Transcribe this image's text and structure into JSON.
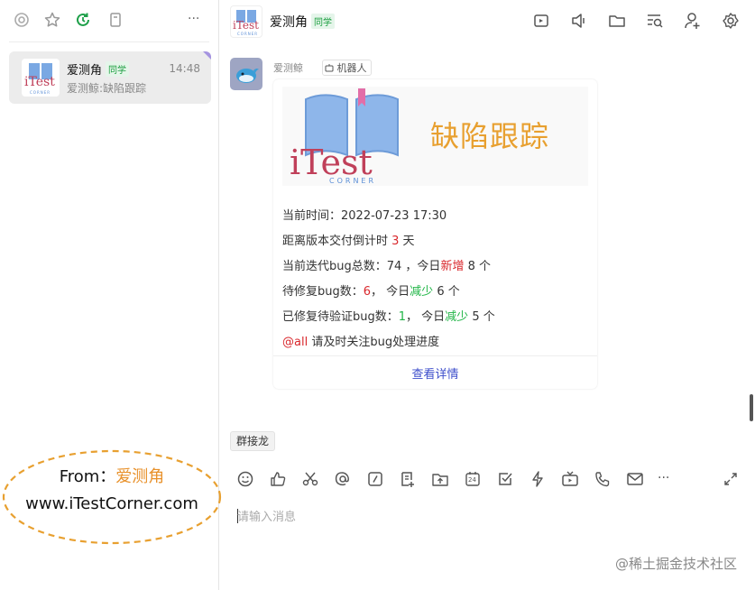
{
  "sidebar": {
    "icons": [
      "at-icon",
      "star-icon",
      "refresh-icon",
      "bookmark-icon",
      "more-icon"
    ],
    "more_label": "···",
    "conversation": {
      "name": "爱测角",
      "tag": "同学",
      "time": "14:48",
      "preview": "爱测鲸:缺陷跟踪",
      "logo_text": "iTest",
      "logo_sub": "CORNER"
    }
  },
  "stamp": {
    "prefix": "From：",
    "name": "爱测角",
    "url": "www.iTestCorner.com"
  },
  "header": {
    "title": "爱测角",
    "tag": "同学",
    "logo_text": "iTest",
    "logo_sub": "CORNER",
    "icons": [
      "screen-share-icon",
      "speaker-icon",
      "folder-icon",
      "search-list-icon",
      "add-user-icon",
      "settings-icon"
    ]
  },
  "message": {
    "sender": "爱测鲸",
    "robot_label": "机器人",
    "banner": {
      "title": "缺陷跟踪",
      "brand": "iTest",
      "brand_sub": "CORNER"
    },
    "lines": {
      "time_label": "当前时间：",
      "time_value": "2022-07-23 17:30",
      "countdown_prefix": "距离版本交付倒计时 ",
      "countdown_value": "3",
      "countdown_suffix": " 天",
      "total_prefix": "当前迭代bug总数：",
      "total_value": "74",
      "total_mid": " ，今日",
      "total_new_label": "新增",
      "total_new_value": " 8 个",
      "pending_prefix": "待修复bug数：",
      "pending_value": "6",
      "pending_mid": "， 今日",
      "pending_dec_label": "减少",
      "pending_dec_value": " 6 个",
      "verify_prefix": "已修复待验证bug数：",
      "verify_value": "1",
      "verify_mid": "， 今日",
      "verify_dec_label": "减少",
      "verify_dec_value": " 5 个",
      "at_label": "@all",
      "at_text": " 请及时关注bug处理进度"
    },
    "detail_link": "查看详情"
  },
  "chip": "群接龙",
  "toolbar": {
    "icons": [
      "emoji-icon",
      "thumb-up-icon",
      "scissors-icon",
      "at-icon",
      "slash-command-icon",
      "add-doc-icon",
      "upload-icon",
      "calendar-icon",
      "checkbox-icon",
      "lightning-icon",
      "live-tv-icon",
      "phone-icon",
      "mail-icon",
      "more-icon"
    ],
    "calendar_label": "24",
    "more_label": "···"
  },
  "input": {
    "placeholder": "请输入消息"
  },
  "watermark": "@稀土掘金技术社区",
  "colors": {
    "accent": "#3d4ecb",
    "red": "#d9282d",
    "green": "#1fb545",
    "orange": "#e8912b",
    "sidebar_active": "#ececec"
  }
}
